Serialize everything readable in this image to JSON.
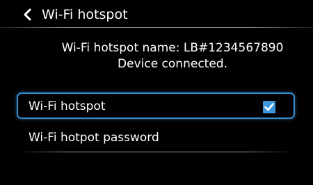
{
  "header": {
    "title": "Wi-Fi hotspot",
    "back_icon": "chevron-left-icon"
  },
  "info": {
    "hotspot_name": "Wi-Fi hotspot name: LB#1234567890",
    "status": "Device connected."
  },
  "settings": {
    "hotspot_toggle": {
      "label": "Wi-Fi hotspot",
      "checked": true,
      "icon": "checkbox-checked-icon"
    },
    "password": {
      "label": "Wi-Fi hotpot password"
    }
  },
  "colors": {
    "background": "#000000",
    "text": "#ffffff",
    "focus_border": "#3a8fd0",
    "checkbox": "#3b95db"
  }
}
